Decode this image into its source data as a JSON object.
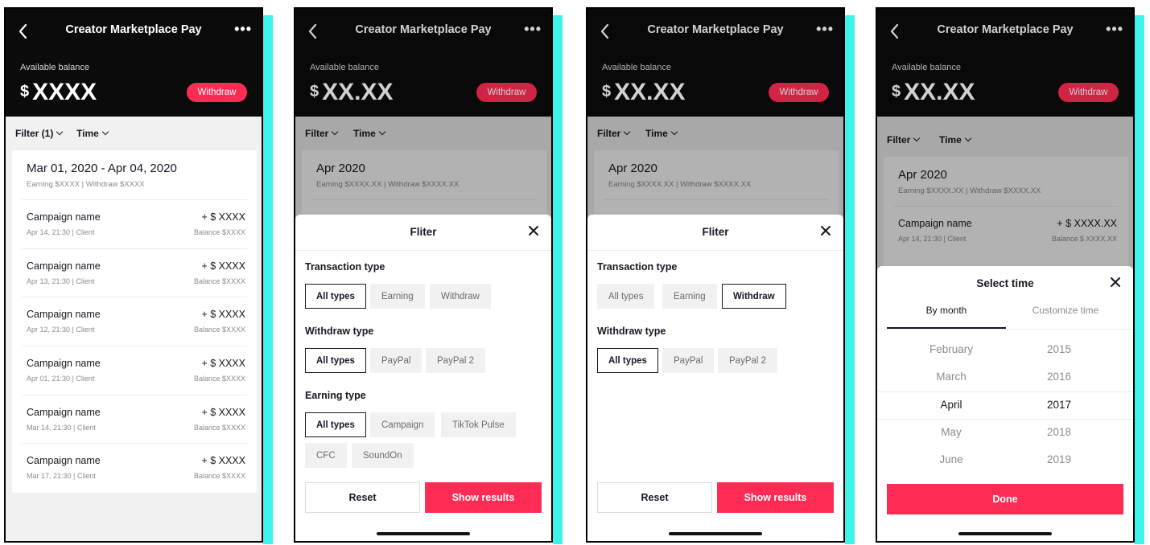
{
  "app": {
    "title": "Creator Marketplace Pay",
    "more": "•••",
    "balance_label": "Available balance",
    "currency": "$",
    "withdraw": "Withdraw"
  },
  "screens": [
    {
      "balance": "XXXX",
      "filter_label": "Filter (1)",
      "time_label": "Time",
      "range_title": "Mar 01, 2020 - Apr 04, 2020",
      "range_sub": "Earning $XXXX | Withdraw $XXXX",
      "transactions": [
        {
          "name": "Campaign name",
          "meta": "Apr 14, 21:30 | Client",
          "amount": "+ $ XXXX",
          "balance": "Balance $XXXX"
        },
        {
          "name": "Campaign name",
          "meta": "Apr 13, 21:30 | Client",
          "amount": "+ $ XXXX",
          "balance": "Balance $XXXX"
        },
        {
          "name": "Campaign name",
          "meta": "Apr 12, 21:30 | Client",
          "amount": "+ $ XXXX",
          "balance": "Balance $XXXX"
        },
        {
          "name": "Campaign name",
          "meta": "Apr 01, 21:30 | Client",
          "amount": "+ $ XXXX",
          "balance": "Balance $XXXX"
        },
        {
          "name": "Campaign name",
          "meta": "Mar 14, 21:30 | Client",
          "amount": "+ $ XXXX",
          "balance": "Balance $XXXX"
        },
        {
          "name": "Campaign name",
          "meta": "Mar 17, 21:30 | Client",
          "amount": "+ $ XXXX",
          "balance": "Balance $XXXX"
        }
      ]
    },
    {
      "balance": "XX.XX",
      "filter_label": "Filter",
      "time_label": "Time",
      "month_title": "Apr 2020",
      "month_sub": "Earning $XXXX.XX | Withdraw $XXXX.XX",
      "sheet_title": "Fliter",
      "transaction_type": {
        "title": "Transaction type",
        "options": [
          "All types",
          "Earning",
          "Withdraw"
        ],
        "selected": 0
      },
      "withdraw_type": {
        "title": "Withdraw type",
        "options": [
          "All types",
          "PayPal",
          "PayPal 2"
        ],
        "selected": 0
      },
      "earning_type": {
        "title": "Earning type",
        "options": [
          "All types",
          "Campaign",
          "TikTok Pulse",
          "CFC",
          "SoundOn"
        ],
        "selected": 0
      },
      "reset": "Reset",
      "show_results": "Show results"
    },
    {
      "balance": "XX.XX",
      "filter_label": "Filter",
      "time_label": "Time",
      "month_title": "Apr 2020",
      "month_sub": "Earning $XXXX.XX | Withdraw $XXXX.XX",
      "sheet_title": "Fliter",
      "transaction_type": {
        "title": "Transaction type",
        "options": [
          "All types",
          "Earning",
          "Withdraw"
        ],
        "selected": 2
      },
      "withdraw_type": {
        "title": "Withdraw type",
        "options": [
          "All types",
          "PayPal",
          "PayPal 2"
        ],
        "selected": 0
      },
      "reset": "Reset",
      "show_results": "Show results"
    },
    {
      "balance": "XX.XX",
      "filter_label": "Filter",
      "time_label": "Time",
      "month_title": "Apr 2020",
      "month_sub": "Earning $XXXX.XX | Withdraw $XXXX.XX",
      "tx_name": "Campaign name",
      "tx_meta": "Apr 14, 21:30 | Client",
      "tx_amount": "+  $ XXXX.XX",
      "tx_balance": "Balance  $ XXXX.XX",
      "sheet_title": "Select time",
      "tab_month": "By month",
      "tab_custom": "Customize time",
      "months": [
        "February",
        "March",
        "April",
        "May",
        "June"
      ],
      "years": [
        "2015",
        "2016",
        "2017",
        "2018",
        "2019"
      ],
      "selected_index": 2,
      "done": "Done"
    }
  ]
}
